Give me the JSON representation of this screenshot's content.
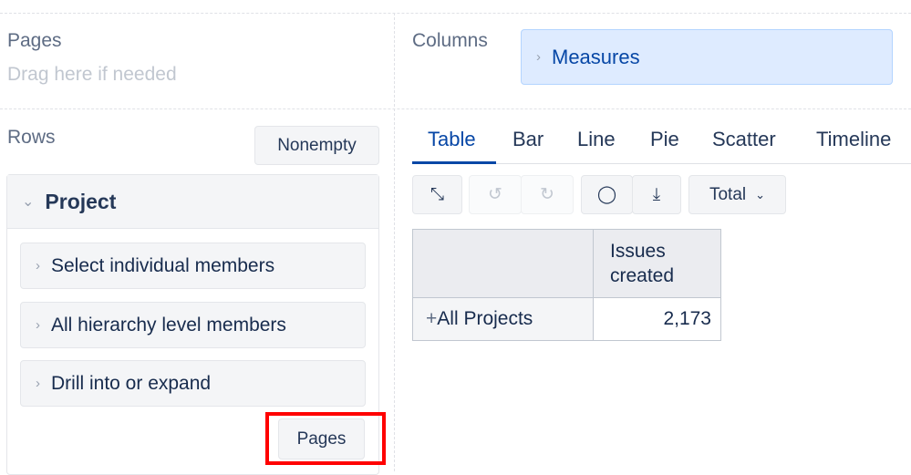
{
  "pages": {
    "label": "Pages",
    "placeholder": "Drag here if needed"
  },
  "columns": {
    "label": "Columns",
    "chip": "Measures"
  },
  "rows": {
    "label": "Rows",
    "nonempty": "Nonempty",
    "dimension": "Project",
    "options": [
      "Select individual members",
      "All hierarchy level members",
      "Drill into or expand"
    ],
    "pages_button": "Pages"
  },
  "tabs": [
    "Table",
    "Bar",
    "Line",
    "Pie",
    "Scatter",
    "Timeline"
  ],
  "toolbar": {
    "total": "Total"
  },
  "table": {
    "header": "Issues created",
    "row_label": "All Projects",
    "value": "2,173"
  },
  "colors": {
    "accent": "#0747a6",
    "highlight": "#ff0000",
    "chip_bg": "#deebff"
  }
}
